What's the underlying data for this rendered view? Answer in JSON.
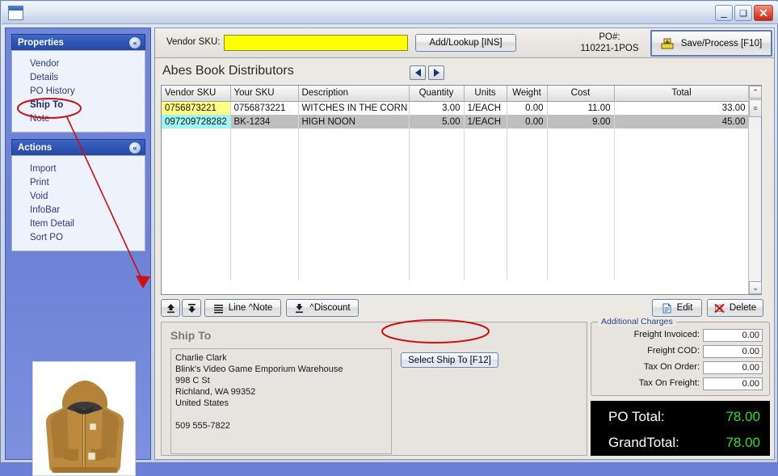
{
  "window": {
    "title": "",
    "minimize_label": "–",
    "maximize_label": "❑",
    "close_label": "✕"
  },
  "sidebar": {
    "groups": [
      {
        "title": "Properties",
        "collapse_label": "«",
        "items": [
          {
            "label": "Vendor",
            "selected": false
          },
          {
            "label": "Details",
            "selected": false
          },
          {
            "label": "PO History",
            "selected": false
          },
          {
            "label": "Ship To",
            "selected": true
          },
          {
            "label": "Note",
            "selected": false
          }
        ]
      },
      {
        "title": "Actions",
        "collapse_label": "«",
        "items": [
          {
            "label": "Import",
            "selected": false
          },
          {
            "label": "Print",
            "selected": false
          },
          {
            "label": "Void",
            "selected": false
          },
          {
            "label": "InfoBar",
            "selected": false
          },
          {
            "label": "Item Detail",
            "selected": false
          },
          {
            "label": "Sort PO",
            "selected": false
          }
        ]
      }
    ],
    "thumbnail_alt": "brown hooded jacket product photo"
  },
  "toolbar": {
    "vendor_sku_label": "Vendor SKU:",
    "vendor_sku_value": "",
    "vendor_sku_placeholder": "",
    "add_lookup_label": "Add/Lookup [INS]",
    "po_number_label": "PO#:",
    "po_number_value": "110221-1POS",
    "save_process_label": "Save/Process [F10]"
  },
  "vendor": {
    "name": "Abes Book Distributors",
    "prev_label": "◄",
    "next_label": "►"
  },
  "grid": {
    "columns": [
      "Vendor SKU",
      "Your SKU",
      "Description",
      "Quantity",
      "Units",
      "Weight",
      "Cost",
      "Total"
    ],
    "rows": [
      {
        "vendor_sku": "0756873221",
        "your_sku": "0756873221",
        "description": "WITCHES IN THE CORN F",
        "quantity": "3.00",
        "units": "1/EACH",
        "weight": "0.00",
        "cost": "11.00",
        "total": "33.00"
      },
      {
        "vendor_sku": "097209728282",
        "your_sku": "BK-1234",
        "description": "HIGH NOON",
        "quantity": "5.00",
        "units": "1/EACH",
        "weight": "0.00",
        "cost": "9.00",
        "total": "45.00"
      }
    ],
    "scroll_up_label": "⌃",
    "scroll_down_label": "⌄",
    "scroll_thumb_label": "≡"
  },
  "grid_tools": {
    "move_up_label": "",
    "move_down_label": "",
    "line_note_label": "Line ^Note",
    "discount_label": "^Discount",
    "edit_label": "Edit",
    "delete_label": "Delete"
  },
  "shipto": {
    "title": "Ship To",
    "address": "Charlie Clark\nBlink's Video Game Emporium Warehouse\n998 C St\nRichland, WA   99352\nUnited States\n\n509 555-7822",
    "select_button_label": "Select Ship To [F12]"
  },
  "charges": {
    "legend": "Additional Charges",
    "rows": [
      {
        "label": "Freight Invoiced:",
        "value": "0.00"
      },
      {
        "label": "Freight COD:",
        "value": "0.00"
      },
      {
        "label": "Tax On Order:",
        "value": "0.00"
      },
      {
        "label": "Tax On Freight:",
        "value": "0.00"
      }
    ]
  },
  "totals": {
    "po_total_label": "PO Total:",
    "po_total_value": "78.00",
    "grand_total_label": "GrandTotal:",
    "grand_total_value": "78.00",
    "value_color": "#29e02d"
  },
  "annotations": {
    "color": "#cc1111",
    "ellipse_shipto": "Ship To",
    "ellipse_select_shipto": "Select Ship To [F12]",
    "arrow_label": "arrow from Ship To nav item to Ship To panel"
  }
}
